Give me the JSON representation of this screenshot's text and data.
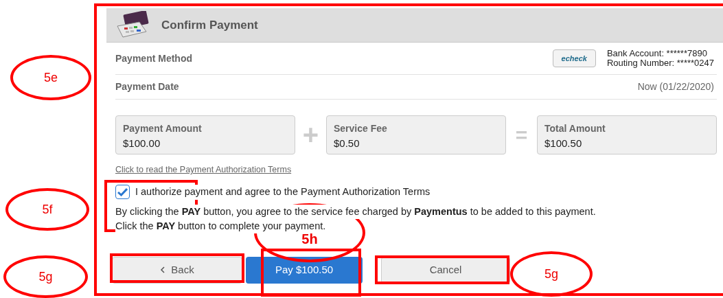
{
  "header": {
    "title": "Confirm Payment"
  },
  "details": [
    {
      "kind": "method",
      "label": "Payment Method",
      "badge": "echeck",
      "lines": [
        "Bank Account: ******7890",
        "Routing Number: *****0247"
      ]
    },
    {
      "kind": "date",
      "label": "Payment Date",
      "value": "Now (01/22/2020)"
    }
  ],
  "amounts": [
    {
      "label": "Payment Amount",
      "value": "$100.00",
      "operator": "+"
    },
    {
      "label": "Service Fee",
      "value": "$0.50",
      "operator": "="
    },
    {
      "label": "Total Amount",
      "value": "$100.50"
    }
  ],
  "terms_link": "Click to read the Payment Authorization Terms",
  "authorize": {
    "label": "I authorize payment and agree to the Payment Authorization Terms",
    "checked": true
  },
  "notice": [
    "By clicking the **PAY** button, you agree to the service fee charged by **Paymentus** to be added to this payment.",
    "Click the **PAY** button to complete your payment."
  ],
  "buttons": [
    {
      "kind": "back",
      "label": "Back"
    },
    {
      "kind": "primary",
      "label": "Pay $100.50"
    },
    {
      "kind": "secondary",
      "label": "Cancel"
    }
  ],
  "callouts": [
    {
      "label": "5e"
    },
    {
      "label": "5f"
    },
    {
      "label": "5g"
    },
    {
      "label": "5h"
    },
    {
      "label": "5g"
    }
  ]
}
